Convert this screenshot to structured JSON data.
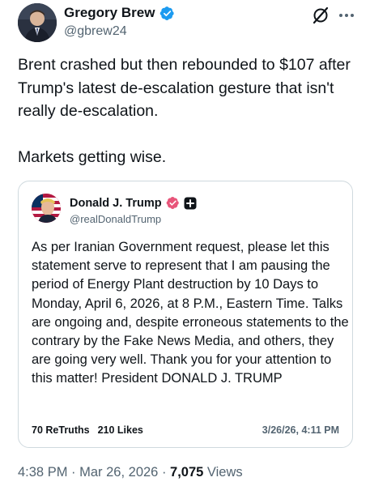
{
  "author": {
    "name": "Gregory Brew",
    "handle": "@gbrew24"
  },
  "tweet": {
    "text": "Brent crashed but then rebounded to $107 after Trump's latest de-escalation gesture that isn't really de-escalation.\n\nMarkets getting wise."
  },
  "quote": {
    "name": "Donald J. Trump",
    "handle": "@realDonaldTrump",
    "body": "As per Iranian Government request, please let this statement serve to represent that I am pausing the period of Energy Plant destruction by 10 Days to Monday, April 6, 2026, at 8 P.M., Eastern Time. Talks are ongoing and, despite erroneous statements to the contrary by the Fake News Media, and others, they are going very well. Thank you for your attention to this matter! President DONALD J. TRUMP",
    "retruths_count": "70",
    "retruths_label": "ReTruths",
    "likes_count": "210",
    "likes_label": "Likes",
    "date": "3/26/26, 4:11 PM"
  },
  "footer": {
    "time": "4:38 PM",
    "separator": " · ",
    "date": "Mar 26, 2026",
    "separator2": " · ",
    "views_count": "7,075",
    "views_label": " Views"
  },
  "colors": {
    "verified_blue": "#1d9bf0",
    "truth_badge_pink": "#e8557a",
    "secondary_text": "#536471",
    "border": "#cfd9de"
  },
  "icons": {
    "verified": "verified-badge-icon",
    "grok": "grok-icon",
    "more": "more-icon",
    "truth_verified": "truth-verified-icon",
    "truth_plus": "truth-plus-icon"
  }
}
